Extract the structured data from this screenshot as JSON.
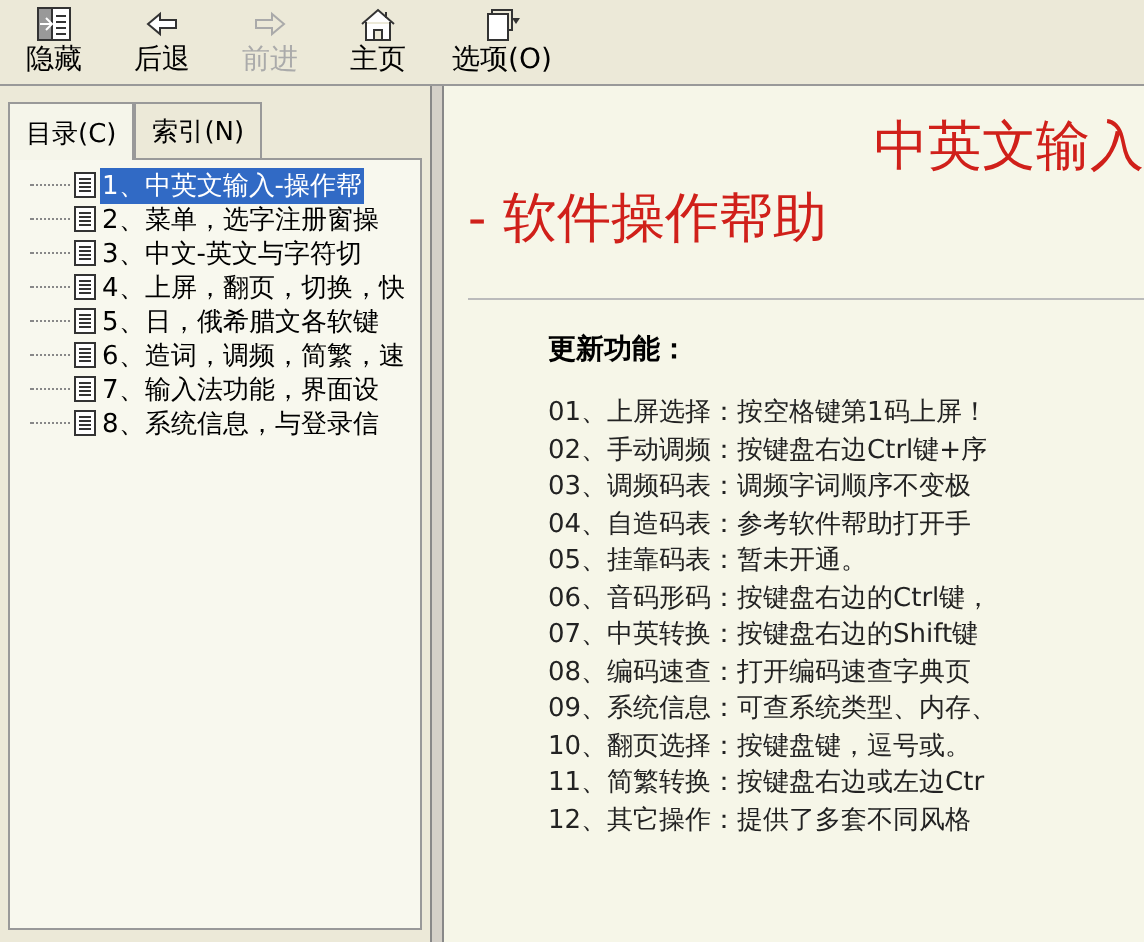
{
  "toolbar": [
    {
      "label": "隐藏",
      "kind": "hide",
      "disabled": false
    },
    {
      "label": "后退",
      "kind": "back",
      "disabled": false
    },
    {
      "label": "前进",
      "kind": "forward",
      "disabled": true
    },
    {
      "label": "主页",
      "kind": "home",
      "disabled": false
    },
    {
      "label": "选项(O)",
      "kind": "options",
      "disabled": false
    }
  ],
  "tabs": [
    {
      "label": "目录(C)",
      "selected": true
    },
    {
      "label": "索引(N)",
      "selected": false
    }
  ],
  "contents": [
    {
      "label": "1、中英文输入-操作帮",
      "selected": true
    },
    {
      "label": "2、菜单，选字注册窗操",
      "selected": false
    },
    {
      "label": "3、中文-英文与字符切",
      "selected": false
    },
    {
      "label": "4、上屏，翻页，切换，快",
      "selected": false
    },
    {
      "label": "5、日，俄希腊文各软键",
      "selected": false
    },
    {
      "label": "6、造词，调频，简繁，速",
      "selected": false
    },
    {
      "label": "7、输入法功能，界面设",
      "selected": false
    },
    {
      "label": "8、系统信息，与登录信",
      "selected": false
    }
  ],
  "page": {
    "title_lines": [
      "中英文输入",
      "- 软件操作帮助"
    ],
    "section_heading": "更新功能：",
    "items": [
      "01、上屏选择：按空格键第1码上屏！",
      "02、手动调频：按键盘右边Ctrl键+序",
      "03、调频码表：调频字词顺序不变极",
      "04、自造码表：参考软件帮助打开手",
      "05、挂靠码表：暂未开通。",
      "06、音码形码：按键盘右边的Ctrl键，",
      "07、中英转换：按键盘右边的Shift键",
      "08、编码速查：打开编码速查字典页",
      "09、系统信息：可查系统类型、内存、",
      "10、翻页选择：按键盘键，逗号或。",
      "11、简繁转换：按键盘右边或左边Ctr",
      "12、其它操作：提供了多套不同风格"
    ]
  }
}
